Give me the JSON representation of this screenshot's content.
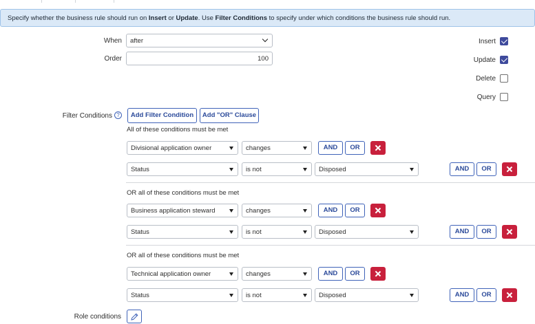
{
  "banner": {
    "part1": "Specify whether the business rule should run on ",
    "insert": "Insert",
    "part2": " or ",
    "update": "Update",
    "part3": ". Use ",
    "filter": "Filter Conditions",
    "part4": " to specify under which conditions the business rule should run."
  },
  "form": {
    "when_label": "When",
    "when_value": "after",
    "order_label": "Order",
    "order_value": "100",
    "filter_conditions_label": "Filter Conditions",
    "role_conditions_label": "Role conditions",
    "add_filter_condition": "Add Filter Condition",
    "add_or_clause": "Add \"OR\" Clause"
  },
  "checkboxes": [
    {
      "label": "Insert",
      "checked": true
    },
    {
      "label": "Update",
      "checked": true
    },
    {
      "label": "Delete",
      "checked": false
    },
    {
      "label": "Query",
      "checked": false
    }
  ],
  "groups": [
    {
      "title": "All of these conditions must be met",
      "rows": [
        {
          "field": "Divisional application owner",
          "operator": "changes",
          "value": ""
        },
        {
          "field": "Status",
          "operator": "is not",
          "value": "Disposed"
        }
      ]
    },
    {
      "title": "OR all of these conditions must be met",
      "rows": [
        {
          "field": "Business application steward",
          "operator": "changes",
          "value": ""
        },
        {
          "field": "Status",
          "operator": "is not",
          "value": "Disposed"
        }
      ]
    },
    {
      "title": "OR all of these conditions must be met",
      "rows": [
        {
          "field": "Technical application owner",
          "operator": "changes",
          "value": ""
        },
        {
          "field": "Status",
          "operator": "is not",
          "value": "Disposed"
        }
      ]
    }
  ],
  "buttons": {
    "and": "AND",
    "or": "OR"
  },
  "icons": {
    "help": "help-circle-icon",
    "delete": "close-icon",
    "edit": "pencil-icon"
  },
  "colors": {
    "banner_bg": "#dbe9f7",
    "accent": "#3e62b8",
    "checkbox": "#3e4a9c",
    "delete": "#c8203c"
  }
}
